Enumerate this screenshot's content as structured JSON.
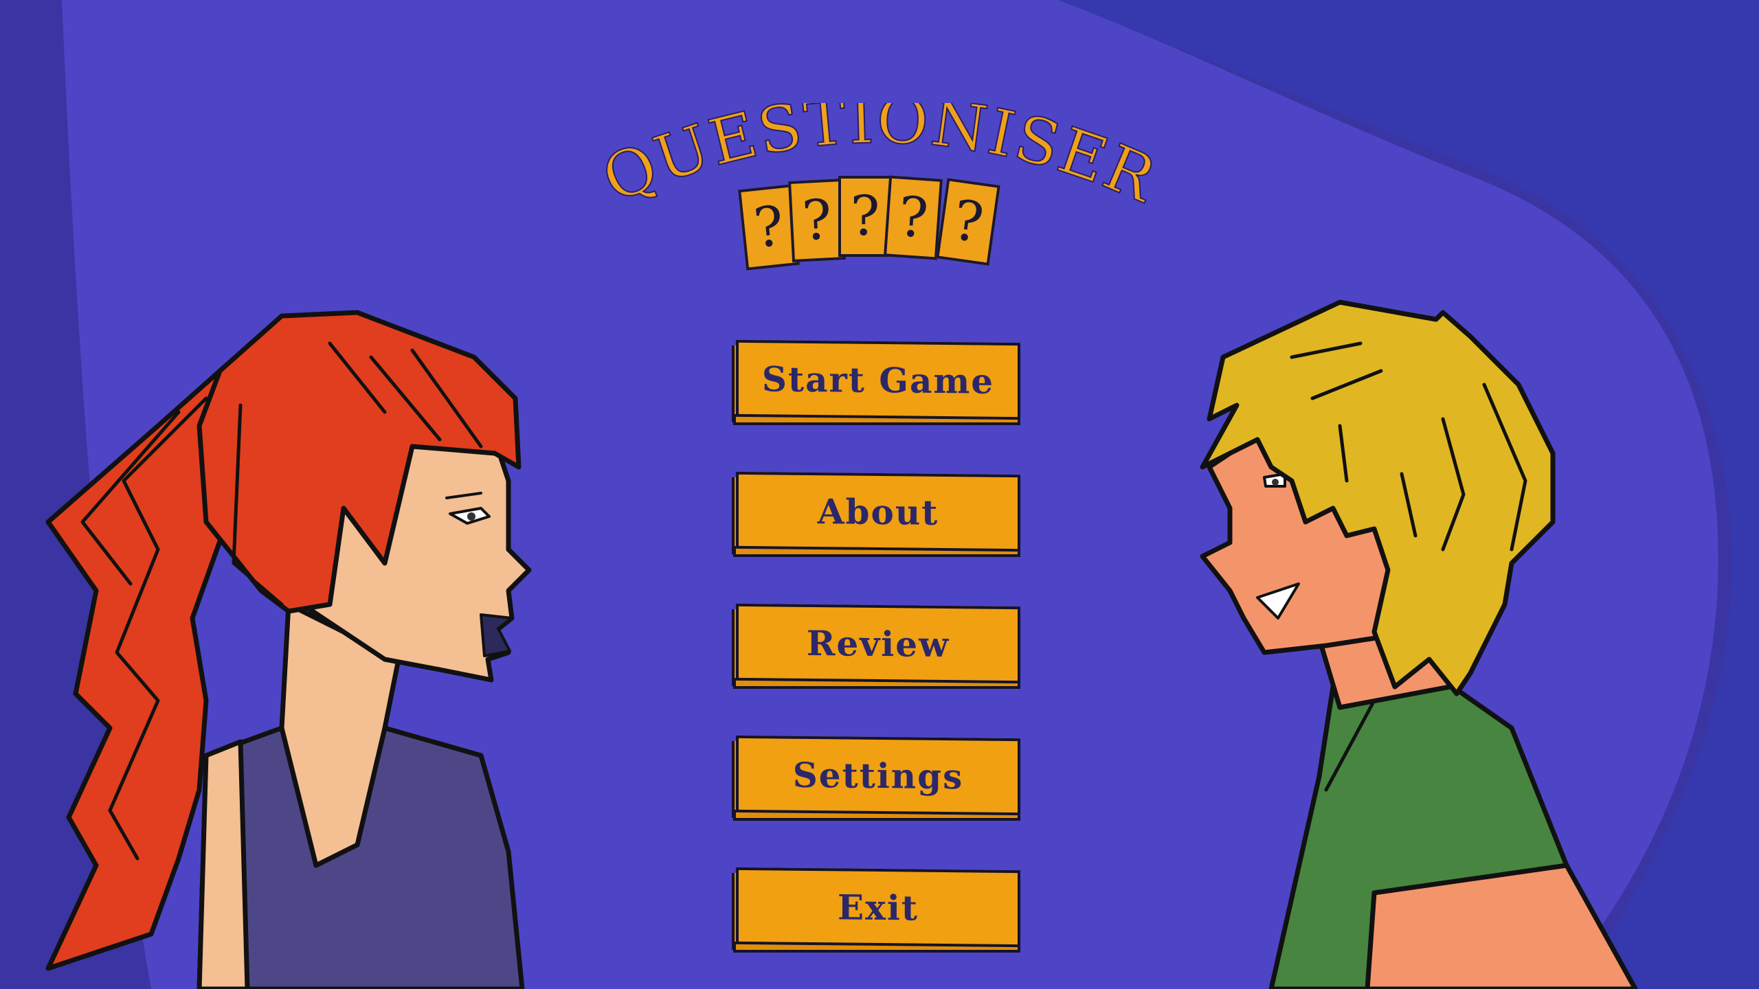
{
  "game": {
    "title": "QUESTIONISER",
    "cards": [
      "?",
      "?",
      "?",
      "?",
      "?"
    ]
  },
  "menu": {
    "items": [
      {
        "label": "Start Game"
      },
      {
        "label": "About"
      },
      {
        "label": "Review"
      },
      {
        "label": "Settings"
      },
      {
        "label": "Exit"
      }
    ]
  },
  "colors": {
    "background": "#3b35a4",
    "spotlight": "#4f46c8",
    "accent": "#f0a011",
    "button_text": "#2c2768",
    "outline": "#15122a"
  }
}
